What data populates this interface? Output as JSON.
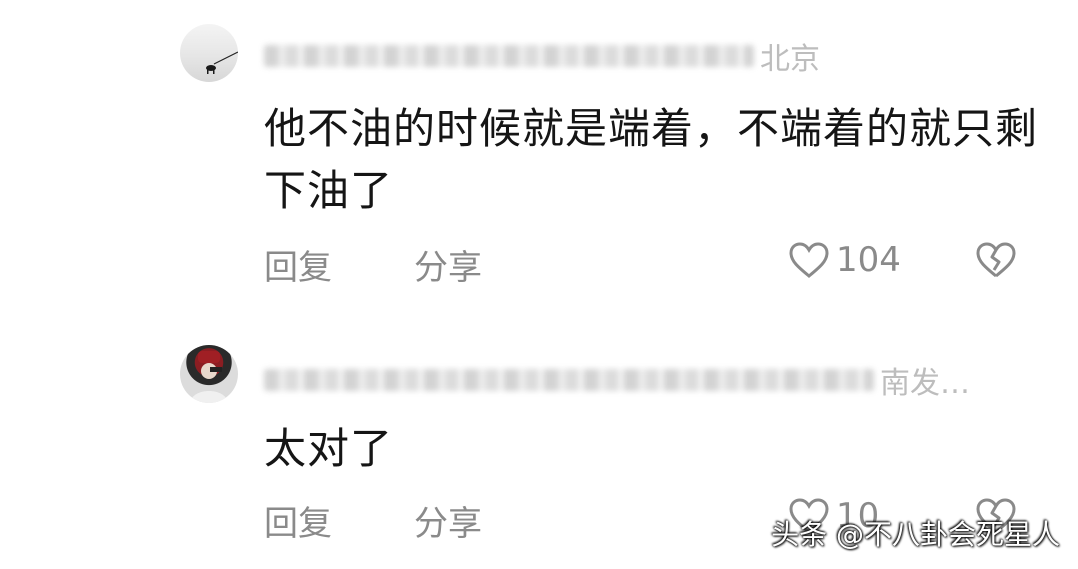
{
  "comments": [
    {
      "meta_suffix": "北京",
      "text": "他不油的时候就是端着，不端着的就只剩下油了",
      "reply_label": "回复",
      "share_label": "分享",
      "like_count": "104"
    },
    {
      "meta_suffix": "南发…",
      "text": "太对了",
      "reply_label": "回复",
      "share_label": "分享",
      "like_count": "10"
    }
  ],
  "watermark": "头条 @不八卦会死星人",
  "icons": [
    "heart-outline-icon",
    "broken-heart-icon"
  ],
  "colors": {
    "text": "#151515",
    "muted": "#8a8a8a",
    "background": "#ffffff"
  }
}
